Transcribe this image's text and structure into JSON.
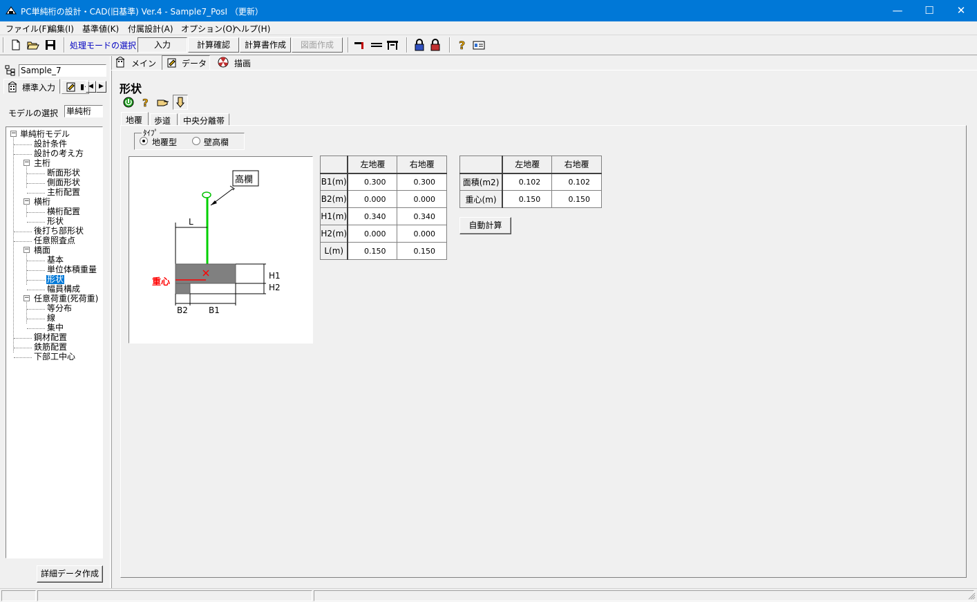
{
  "window": {
    "title": "PC単純桁の設計・CAD(旧基準) Ver.4 - Sample7_PosI （更新）",
    "minimize": "—",
    "maximize": "☐",
    "close": "✕"
  },
  "menu": [
    "ファイル(F)",
    "編集(I)",
    "基準値(K)",
    "付属設計(A)",
    "オプション(O)",
    "ヘルプ(H)"
  ],
  "toolbar": {
    "mode_label": "処理モードの選択",
    "buttons": [
      "入力",
      "計算確認",
      "計算書作成",
      "図面作成"
    ]
  },
  "left": {
    "project_name": "Sample_7",
    "tab_label": "標準入力",
    "model_label": "モデルの選択",
    "model_value": "単純桁",
    "tree": [
      "単純桁モデル",
      "設計条件",
      "設計の考え方",
      "主桁",
      "断面形状",
      "側面形状",
      "主桁配置",
      "横桁",
      "横桁配置",
      "形状",
      "後打ち部形状",
      "任意照査点",
      "橋面",
      "基本",
      "単位体積重量",
      "形状",
      "幅員構成",
      "任意荷重(死荷重)",
      "等分布",
      "線",
      "集中",
      "鋼材配置",
      "鉄筋配置",
      "下部工中心"
    ],
    "detail_button": "詳細データ作成"
  },
  "tabs": [
    "メイン",
    "データ",
    "描画"
  ],
  "section": {
    "title": "形状",
    "subtabs": [
      "地覆",
      "歩道",
      "中央分離帯"
    ],
    "type_group": "ﾀｲﾌﾟ",
    "radio_options": [
      "地覆型",
      "壁高欄"
    ]
  },
  "figure": {
    "label_kouran": "高欄",
    "label_juushin": "重心",
    "label_L": "L",
    "label_H1": "H1",
    "label_H2": "H2",
    "label_B1": "B1",
    "label_B2": "B2"
  },
  "table1": {
    "headers": [
      "",
      "左地覆",
      "右地覆"
    ],
    "rows": [
      [
        "B1(m)",
        "0.300",
        "0.300"
      ],
      [
        "B2(m)",
        "0.000",
        "0.000"
      ],
      [
        "H1(m)",
        "0.340",
        "0.340"
      ],
      [
        "H2(m)",
        "0.000",
        "0.000"
      ],
      [
        "L(m)",
        "0.150",
        "0.150"
      ]
    ]
  },
  "table2": {
    "headers": [
      "",
      "左地覆",
      "右地覆"
    ],
    "rows": [
      [
        "面積(m2)",
        "0.102",
        "0.102"
      ],
      [
        "重心(m)",
        "0.150",
        "0.150"
      ]
    ]
  },
  "auto_calc_button": "自動計算"
}
